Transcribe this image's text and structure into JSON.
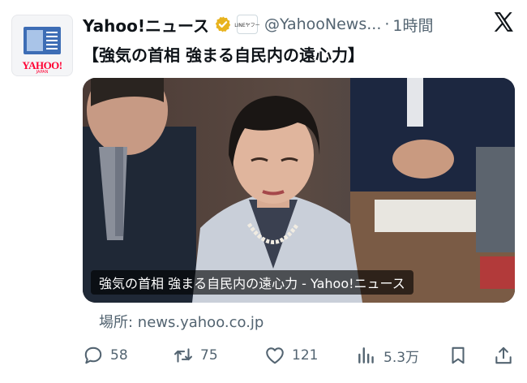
{
  "account": {
    "display_name": "Yahoo!ニュース",
    "handle": "@YahooNews...",
    "separator": "·",
    "time": "1時間",
    "avatar_logo": "YAHOO!",
    "avatar_sub": "JAPAN",
    "affiliation_badge": "LINEヤフー"
  },
  "tweet": {
    "text": "【強気の首相 強まる自民内の遠心力】"
  },
  "media": {
    "caption": "強気の首相 強まる自民内の遠心力 - Yahoo!ニュース"
  },
  "link": {
    "source": "場所: news.yahoo.co.jp"
  },
  "actions": {
    "reply": {
      "icon": "reply-icon",
      "count": "58"
    },
    "repost": {
      "icon": "repost-icon",
      "count": "75"
    },
    "like": {
      "icon": "like-icon",
      "count": "121"
    },
    "views": {
      "icon": "views-icon",
      "count": "5.3万"
    },
    "bookmark": {
      "icon": "bookmark-icon"
    },
    "share": {
      "icon": "share-icon"
    }
  },
  "colors": {
    "text_primary": "#0f1419",
    "text_secondary": "#536471",
    "verified_gold": "#e8b31e",
    "brand_red": "#ff0033"
  }
}
